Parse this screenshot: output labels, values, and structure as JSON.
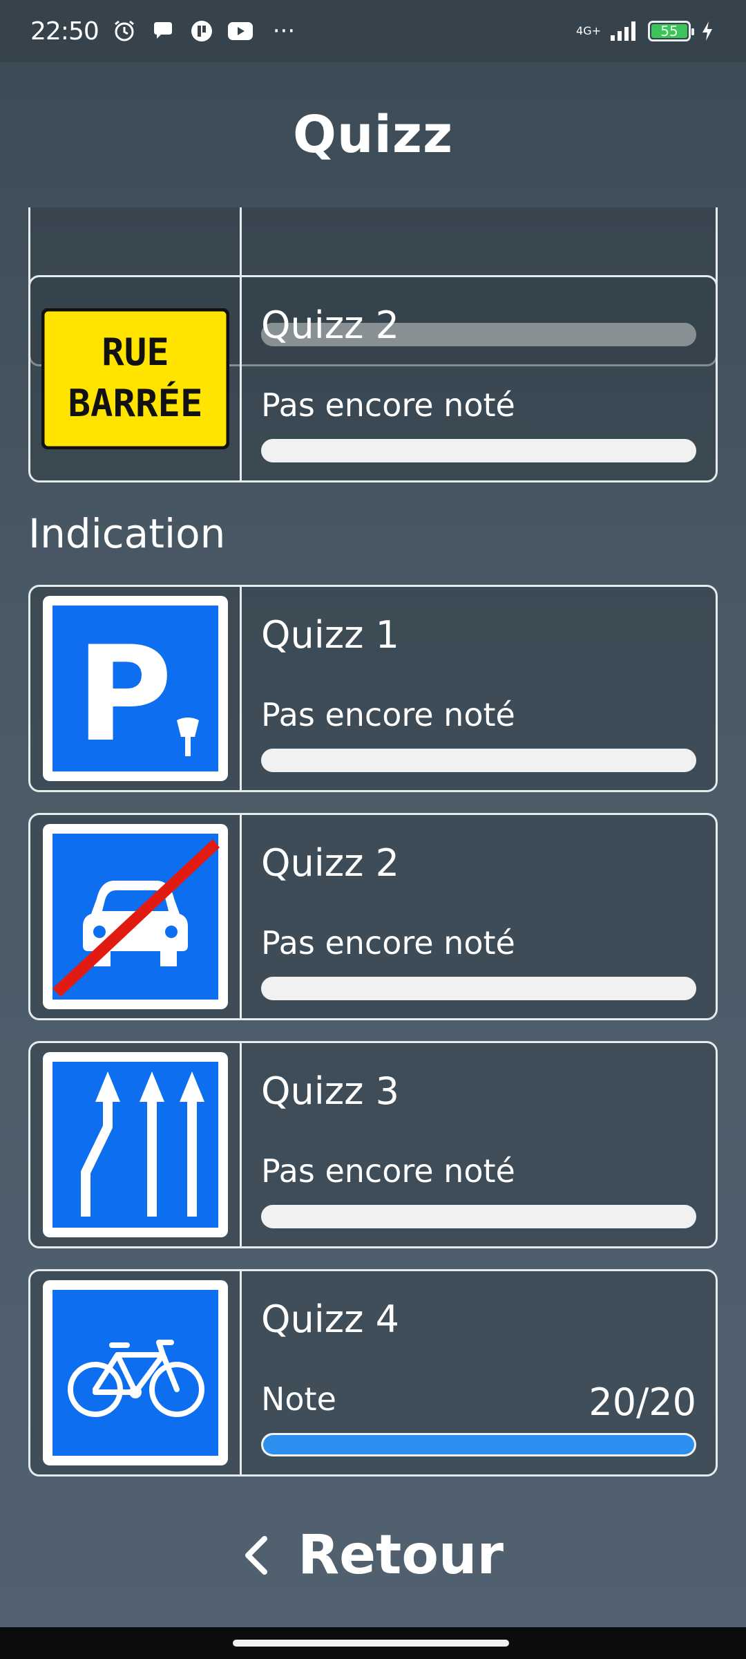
{
  "status_bar": {
    "time": "22:50",
    "network": "4G+",
    "battery": "55",
    "icons": [
      "alarm-icon",
      "chat-icon",
      "notification-app-icon",
      "youtube-icon",
      "more-icon",
      "signal-icon",
      "battery-icon",
      "charging-icon"
    ],
    "more": "···"
  },
  "header": {
    "title": "Quizz"
  },
  "sections": {
    "indication": "Indication"
  },
  "cards": [
    {
      "title": "",
      "status": "",
      "score": "",
      "progress": 0,
      "icon": "warning-sign-partial"
    },
    {
      "title": "Quizz 2",
      "status": "Pas encore noté",
      "score": "",
      "progress": 0,
      "icon": "rue-barree-sign",
      "sign_text_1": "RUE",
      "sign_text_2": "BARRÉE"
    },
    {
      "title": "Quizz 1",
      "status": "Pas encore noté",
      "score": "",
      "progress": 0,
      "icon": "parking-paid-sign",
      "sign_text": "P"
    },
    {
      "title": "Quizz 2",
      "status": "Pas encore noté",
      "score": "",
      "progress": 0,
      "icon": "end-of-motorway-sign"
    },
    {
      "title": "Quizz 3",
      "status": "Pas encore noté",
      "score": "",
      "progress": 0,
      "icon": "lanes-sign"
    },
    {
      "title": "Quizz 4",
      "status": "Note",
      "score": "20/20",
      "progress": 1.0,
      "icon": "bicycle-lane-sign"
    }
  ],
  "footer": {
    "back_label": "Retour"
  },
  "colors": {
    "accent": "#2d8ff0",
    "sign_blue": "#0d6ef0",
    "sign_yellow": "#ffe400",
    "sign_red": "#e11a12"
  }
}
